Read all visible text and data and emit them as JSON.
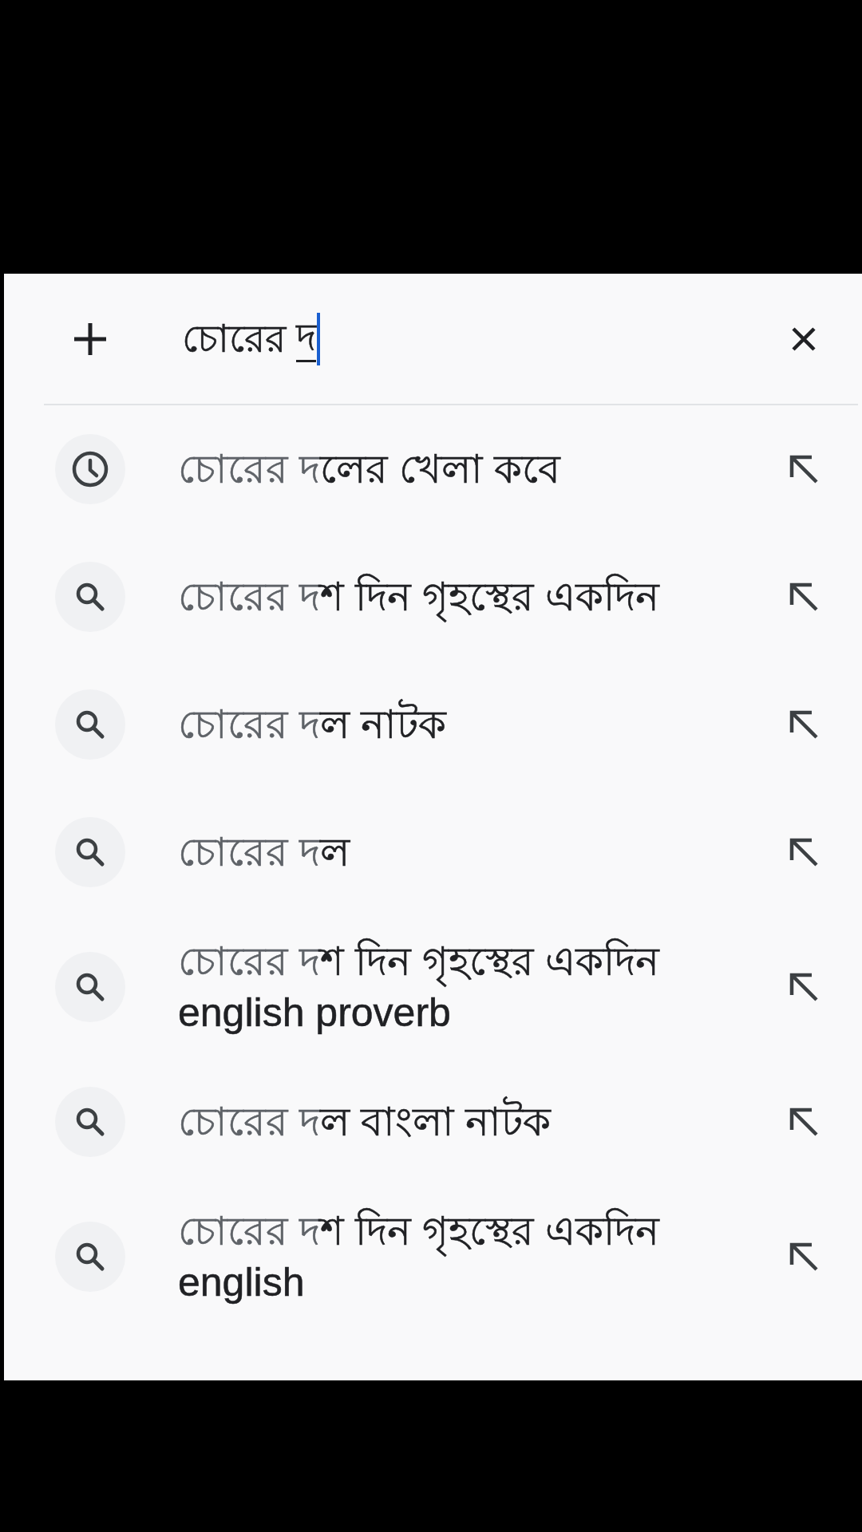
{
  "search_bar": {
    "text": "চোরের ",
    "composing_text": "দ"
  },
  "suggestions": [
    {
      "kind": "history",
      "typed": "চোরের দ",
      "completion": "লের খেলা কবে"
    },
    {
      "kind": "search",
      "typed": "চোরের দ",
      "completion": "শ দিন গৃহস্থের একদিন"
    },
    {
      "kind": "search",
      "typed": "চোরের দ",
      "completion": "ল নাটক"
    },
    {
      "kind": "search",
      "typed": "চোরের দ",
      "completion": "ল"
    },
    {
      "kind": "search",
      "typed": "চোরের দ",
      "completion": "শ দিন গৃহস্থের একদিন english proverb"
    },
    {
      "kind": "search",
      "typed": "চোরের দ",
      "completion": "ল বাংলা নাটক"
    },
    {
      "kind": "search",
      "typed": "চোরের দ",
      "completion": "শ দিন গৃহস্থের একদিন english"
    }
  ]
}
